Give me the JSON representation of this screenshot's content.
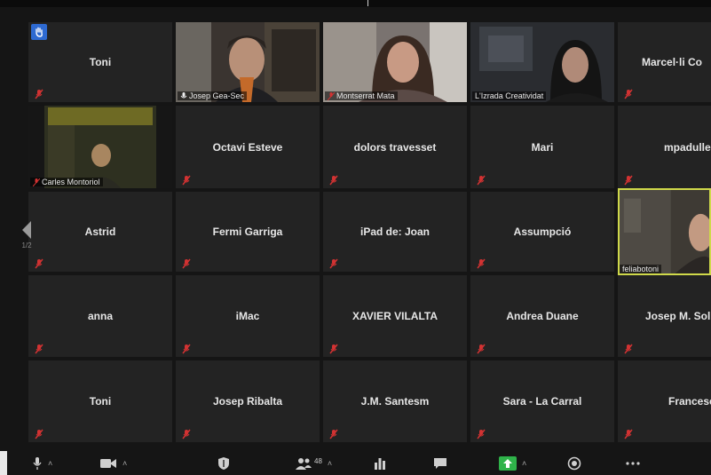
{
  "participants_count": "48",
  "page_indicator": "1/2",
  "tiles": [
    {
      "id": "toni-1",
      "name": "Toni",
      "type": "name"
    },
    {
      "id": "josep-gea",
      "name": "Josep Gea-Sec",
      "type": "video"
    },
    {
      "id": "montserrat",
      "name": "Montserrat Mata",
      "type": "video"
    },
    {
      "id": "lizrada",
      "name": "L'Izrada Creatividat",
      "type": "video"
    },
    {
      "id": "marcel",
      "name": "Marcel·li Co",
      "type": "name"
    },
    {
      "id": "carles",
      "name": "Carles Montoriol",
      "type": "video"
    },
    {
      "id": "octavi",
      "name": "Octavi Esteve",
      "type": "name"
    },
    {
      "id": "dolors",
      "name": "dolors travesset",
      "type": "name"
    },
    {
      "id": "mari",
      "name": "Mari",
      "type": "name"
    },
    {
      "id": "mpadulle",
      "name": "mpadulle",
      "type": "name"
    },
    {
      "id": "astrid",
      "name": "Astrid",
      "type": "name"
    },
    {
      "id": "fermi",
      "name": "Fermi Garriga",
      "type": "name"
    },
    {
      "id": "ipad-joan",
      "name": "iPad de: Joan",
      "type": "name"
    },
    {
      "id": "assumpcio",
      "name": "Assumpció",
      "type": "name"
    },
    {
      "id": "feliabotoni",
      "name": "feliabotoni",
      "type": "video"
    },
    {
      "id": "anna",
      "name": "anna",
      "type": "name"
    },
    {
      "id": "imac",
      "name": "iMac",
      "type": "name"
    },
    {
      "id": "xavier",
      "name": "XAVIER VILALTA",
      "type": "name"
    },
    {
      "id": "andrea",
      "name": "Andrea Duane",
      "type": "name"
    },
    {
      "id": "josep-m",
      "name": "Josep M. Sol",
      "type": "name"
    },
    {
      "id": "toni-2",
      "name": "Toni",
      "type": "name"
    },
    {
      "id": "josep-ribalta",
      "name": "Josep Ribalta",
      "type": "name"
    },
    {
      "id": "jm-santesm",
      "name": "J.M. Santesm",
      "type": "name"
    },
    {
      "id": "sara",
      "name": "Sara - La Carral",
      "type": "name"
    },
    {
      "id": "francesc",
      "name": "Francesc",
      "type": "name"
    }
  ],
  "colors": {
    "muted_icon": "#d23232",
    "active_speaker": "#cfd94a",
    "share_green": "#2fb34a",
    "raise_hand": "#2e6ad1"
  },
  "toolbar_icons": [
    "microphone-icon",
    "video-camera-icon",
    "security-shield-icon",
    "participants-icon",
    "polls-icon",
    "chat-icon",
    "share-screen-icon",
    "record-icon",
    "more-icon"
  ]
}
